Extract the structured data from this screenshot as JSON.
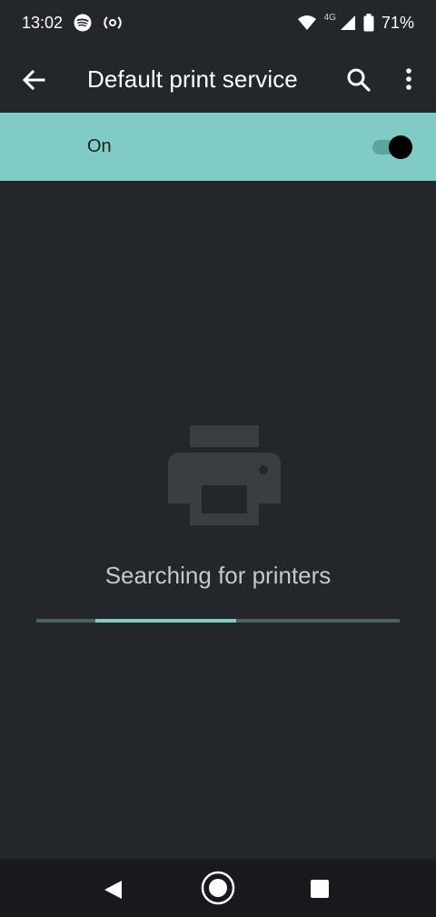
{
  "status_bar": {
    "time": "13:02",
    "network_type": "4G",
    "battery_percent": "71%",
    "icons": [
      "spotify-icon",
      "hotspot-icon",
      "wifi-icon",
      "cellular-signal-icon",
      "battery-icon"
    ]
  },
  "app_bar": {
    "title": "Default print service",
    "icons": [
      "back-arrow-icon",
      "search-icon",
      "more-options-icon"
    ]
  },
  "switch_bar": {
    "label": "On",
    "checked": true
  },
  "empty_state": {
    "icon": "printer-icon",
    "message": "Searching for printers",
    "progress_indeterminate": true
  },
  "nav_bar": {
    "icons": [
      "nav-back-icon",
      "nav-home-icon",
      "nav-recents-icon"
    ]
  },
  "colors": {
    "background": "#23272c",
    "accent": "#80cbc4",
    "switch_bar_bg": "#80cbc4",
    "nav_bar_bg": "#17191c",
    "icon_muted": "#3a3e43"
  }
}
